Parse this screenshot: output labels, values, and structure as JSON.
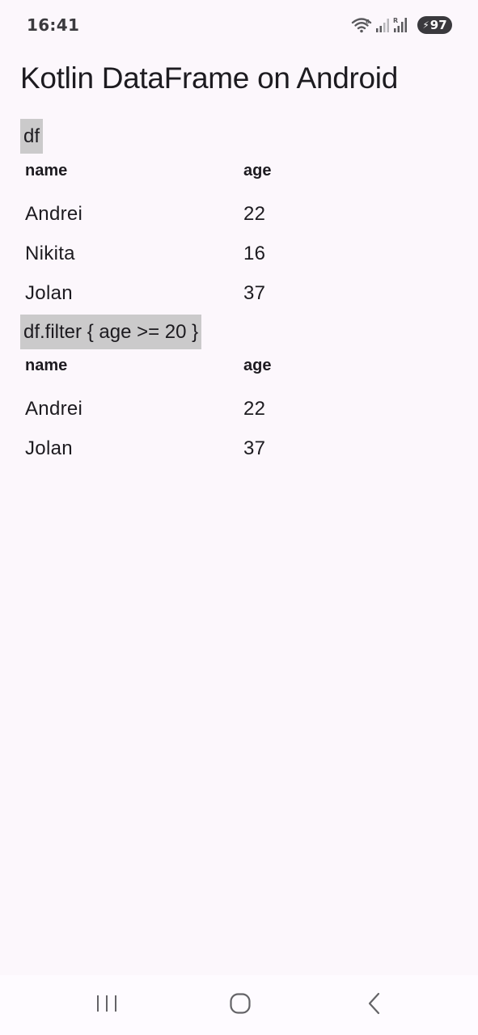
{
  "status_bar": {
    "time": "16:41",
    "battery_level": "97",
    "icons": [
      "wifi-icon",
      "signal-icon",
      "signal-roaming-icon",
      "battery-charging-icon"
    ]
  },
  "app": {
    "title": "Kotlin DataFrame on Android"
  },
  "sections": [
    {
      "code": "df",
      "columns": [
        "name",
        "age"
      ],
      "rows": [
        [
          "Andrei",
          "22"
        ],
        [
          "Nikita",
          "16"
        ],
        [
          "Jolan",
          "37"
        ]
      ]
    },
    {
      "code": "df.filter { age >= 20 }",
      "columns": [
        "name",
        "age"
      ],
      "rows": [
        [
          "Andrei",
          "22"
        ],
        [
          "Jolan",
          "37"
        ]
      ]
    }
  ],
  "nav_bar": {
    "buttons": [
      "recents-icon",
      "home-icon",
      "back-icon"
    ]
  },
  "colors": {
    "background": "#fcf7fc",
    "code_label_bg": "#cbcacb",
    "text": "#1d1b20",
    "nav_bar_bg": "#fefbff"
  }
}
